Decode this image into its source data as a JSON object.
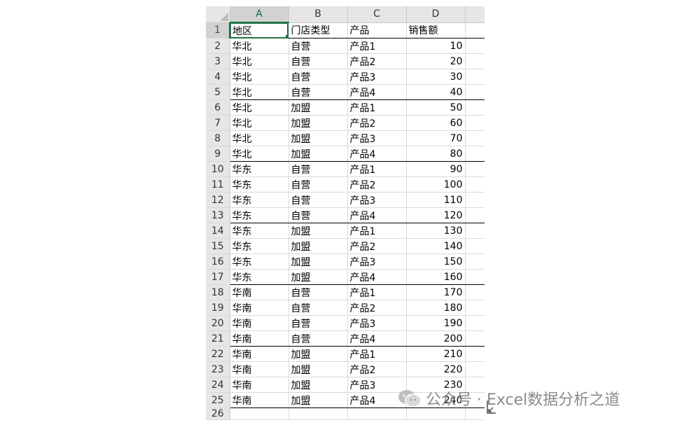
{
  "sheet": {
    "columns": [
      "A",
      "B",
      "C",
      "D"
    ],
    "rows": [
      [
        "地区",
        "门店类型",
        "产品",
        "销售额"
      ],
      [
        "华北",
        "自营",
        "产品1",
        "10"
      ],
      [
        "华北",
        "自营",
        "产品2",
        "20"
      ],
      [
        "华北",
        "自营",
        "产品3",
        "30"
      ],
      [
        "华北",
        "自营",
        "产品4",
        "40"
      ],
      [
        "华北",
        "加盟",
        "产品1",
        "50"
      ],
      [
        "华北",
        "加盟",
        "产品2",
        "60"
      ],
      [
        "华北",
        "加盟",
        "产品3",
        "70"
      ],
      [
        "华北",
        "加盟",
        "产品4",
        "80"
      ],
      [
        "华东",
        "自营",
        "产品1",
        "90"
      ],
      [
        "华东",
        "自营",
        "产品2",
        "100"
      ],
      [
        "华东",
        "自营",
        "产品3",
        "110"
      ],
      [
        "华东",
        "自营",
        "产品4",
        "120"
      ],
      [
        "华东",
        "加盟",
        "产品1",
        "130"
      ],
      [
        "华东",
        "加盟",
        "产品2",
        "140"
      ],
      [
        "华东",
        "加盟",
        "产品3",
        "150"
      ],
      [
        "华东",
        "加盟",
        "产品4",
        "160"
      ],
      [
        "华南",
        "自营",
        "产品1",
        "170"
      ],
      [
        "华南",
        "自营",
        "产品2",
        "180"
      ],
      [
        "华南",
        "自营",
        "产品3",
        "190"
      ],
      [
        "华南",
        "自营",
        "产品4",
        "200"
      ],
      [
        "华南",
        "加盟",
        "产品1",
        "210"
      ],
      [
        "华南",
        "加盟",
        "产品2",
        "220"
      ],
      [
        "华南",
        "加盟",
        "产品3",
        "230"
      ],
      [
        "华南",
        "加盟",
        "产品4",
        "240"
      ]
    ],
    "last_row_number": "26",
    "selected_cell": "A1",
    "accent_color": "#217346"
  },
  "watermark": {
    "text": "公众号 · Excel数据分析之道",
    "icon": "wechat-icon"
  },
  "cursor": {
    "icon": "resize-cursor-icon"
  }
}
